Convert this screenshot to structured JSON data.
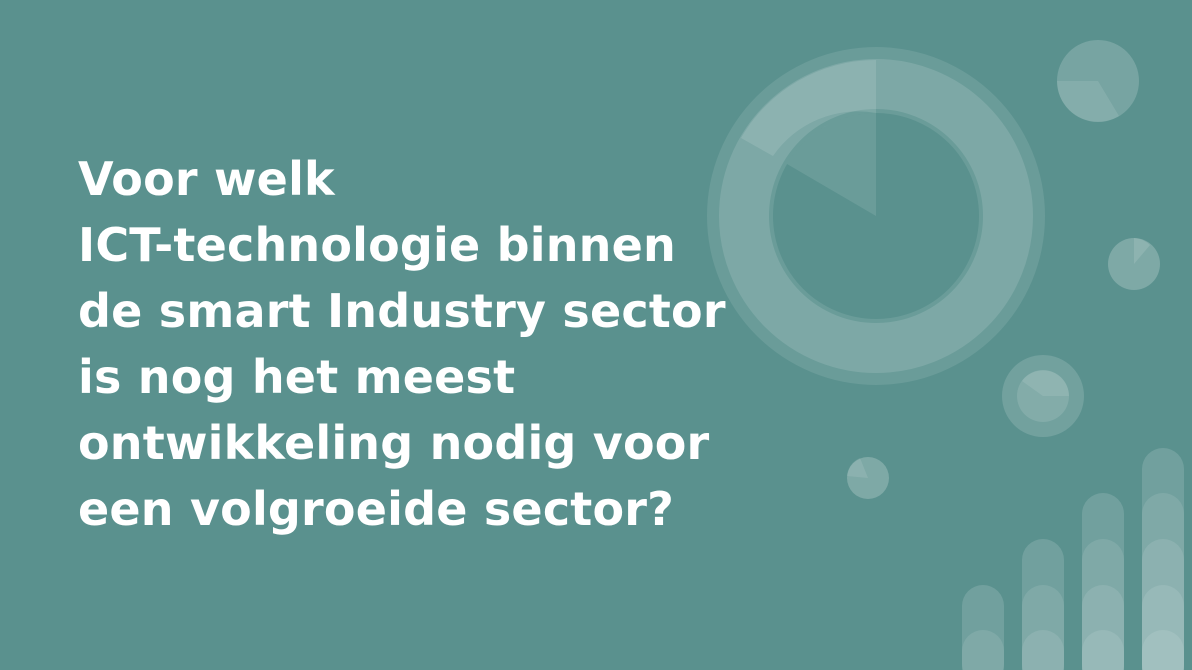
{
  "slide": {
    "question_lines": [
      "Voor welk",
      "ICT-technologie binnen",
      "de smart Industry sector",
      "is nog het meest",
      "ontwikkeling nodig voor",
      "een volgroeide sector?"
    ]
  },
  "colors": {
    "background": "#5a918e",
    "text": "#ffffff",
    "decor_light": "#ffffff"
  },
  "decorations": [
    "donut-chart-graphic",
    "mini-pie-icons",
    "bar-chart-graphic"
  ]
}
